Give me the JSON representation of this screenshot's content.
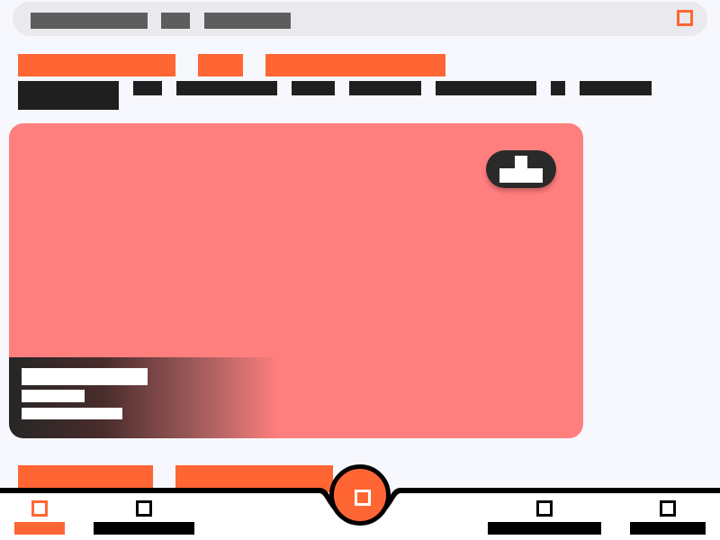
{
  "colors": {
    "accent": "#ff6633",
    "hero_bg": "#ff7f7f",
    "dark": "#1f1f1f",
    "page_bg": "#f7f8fd"
  },
  "search": {
    "placeholder_parts": [
      "",
      "",
      ""
    ],
    "corner_icon": "square-icon"
  },
  "chips": [
    "",
    "",
    ""
  ],
  "filters": [
    "",
    "",
    "",
    "",
    "",
    "",
    "",
    ""
  ],
  "hero": {
    "action_icon": "upload-icon",
    "title": "",
    "subtitle": "",
    "meta": ""
  },
  "sections": [
    "",
    ""
  ],
  "nav": {
    "items": [
      {
        "label": "",
        "icon": "square-icon",
        "active": true
      },
      {
        "label": "",
        "icon": "square-icon",
        "active": false
      },
      {
        "label": "",
        "icon": "square-icon",
        "active": false
      },
      {
        "label": "",
        "icon": "square-icon",
        "active": false
      }
    ],
    "fab_icon": "square-icon"
  }
}
